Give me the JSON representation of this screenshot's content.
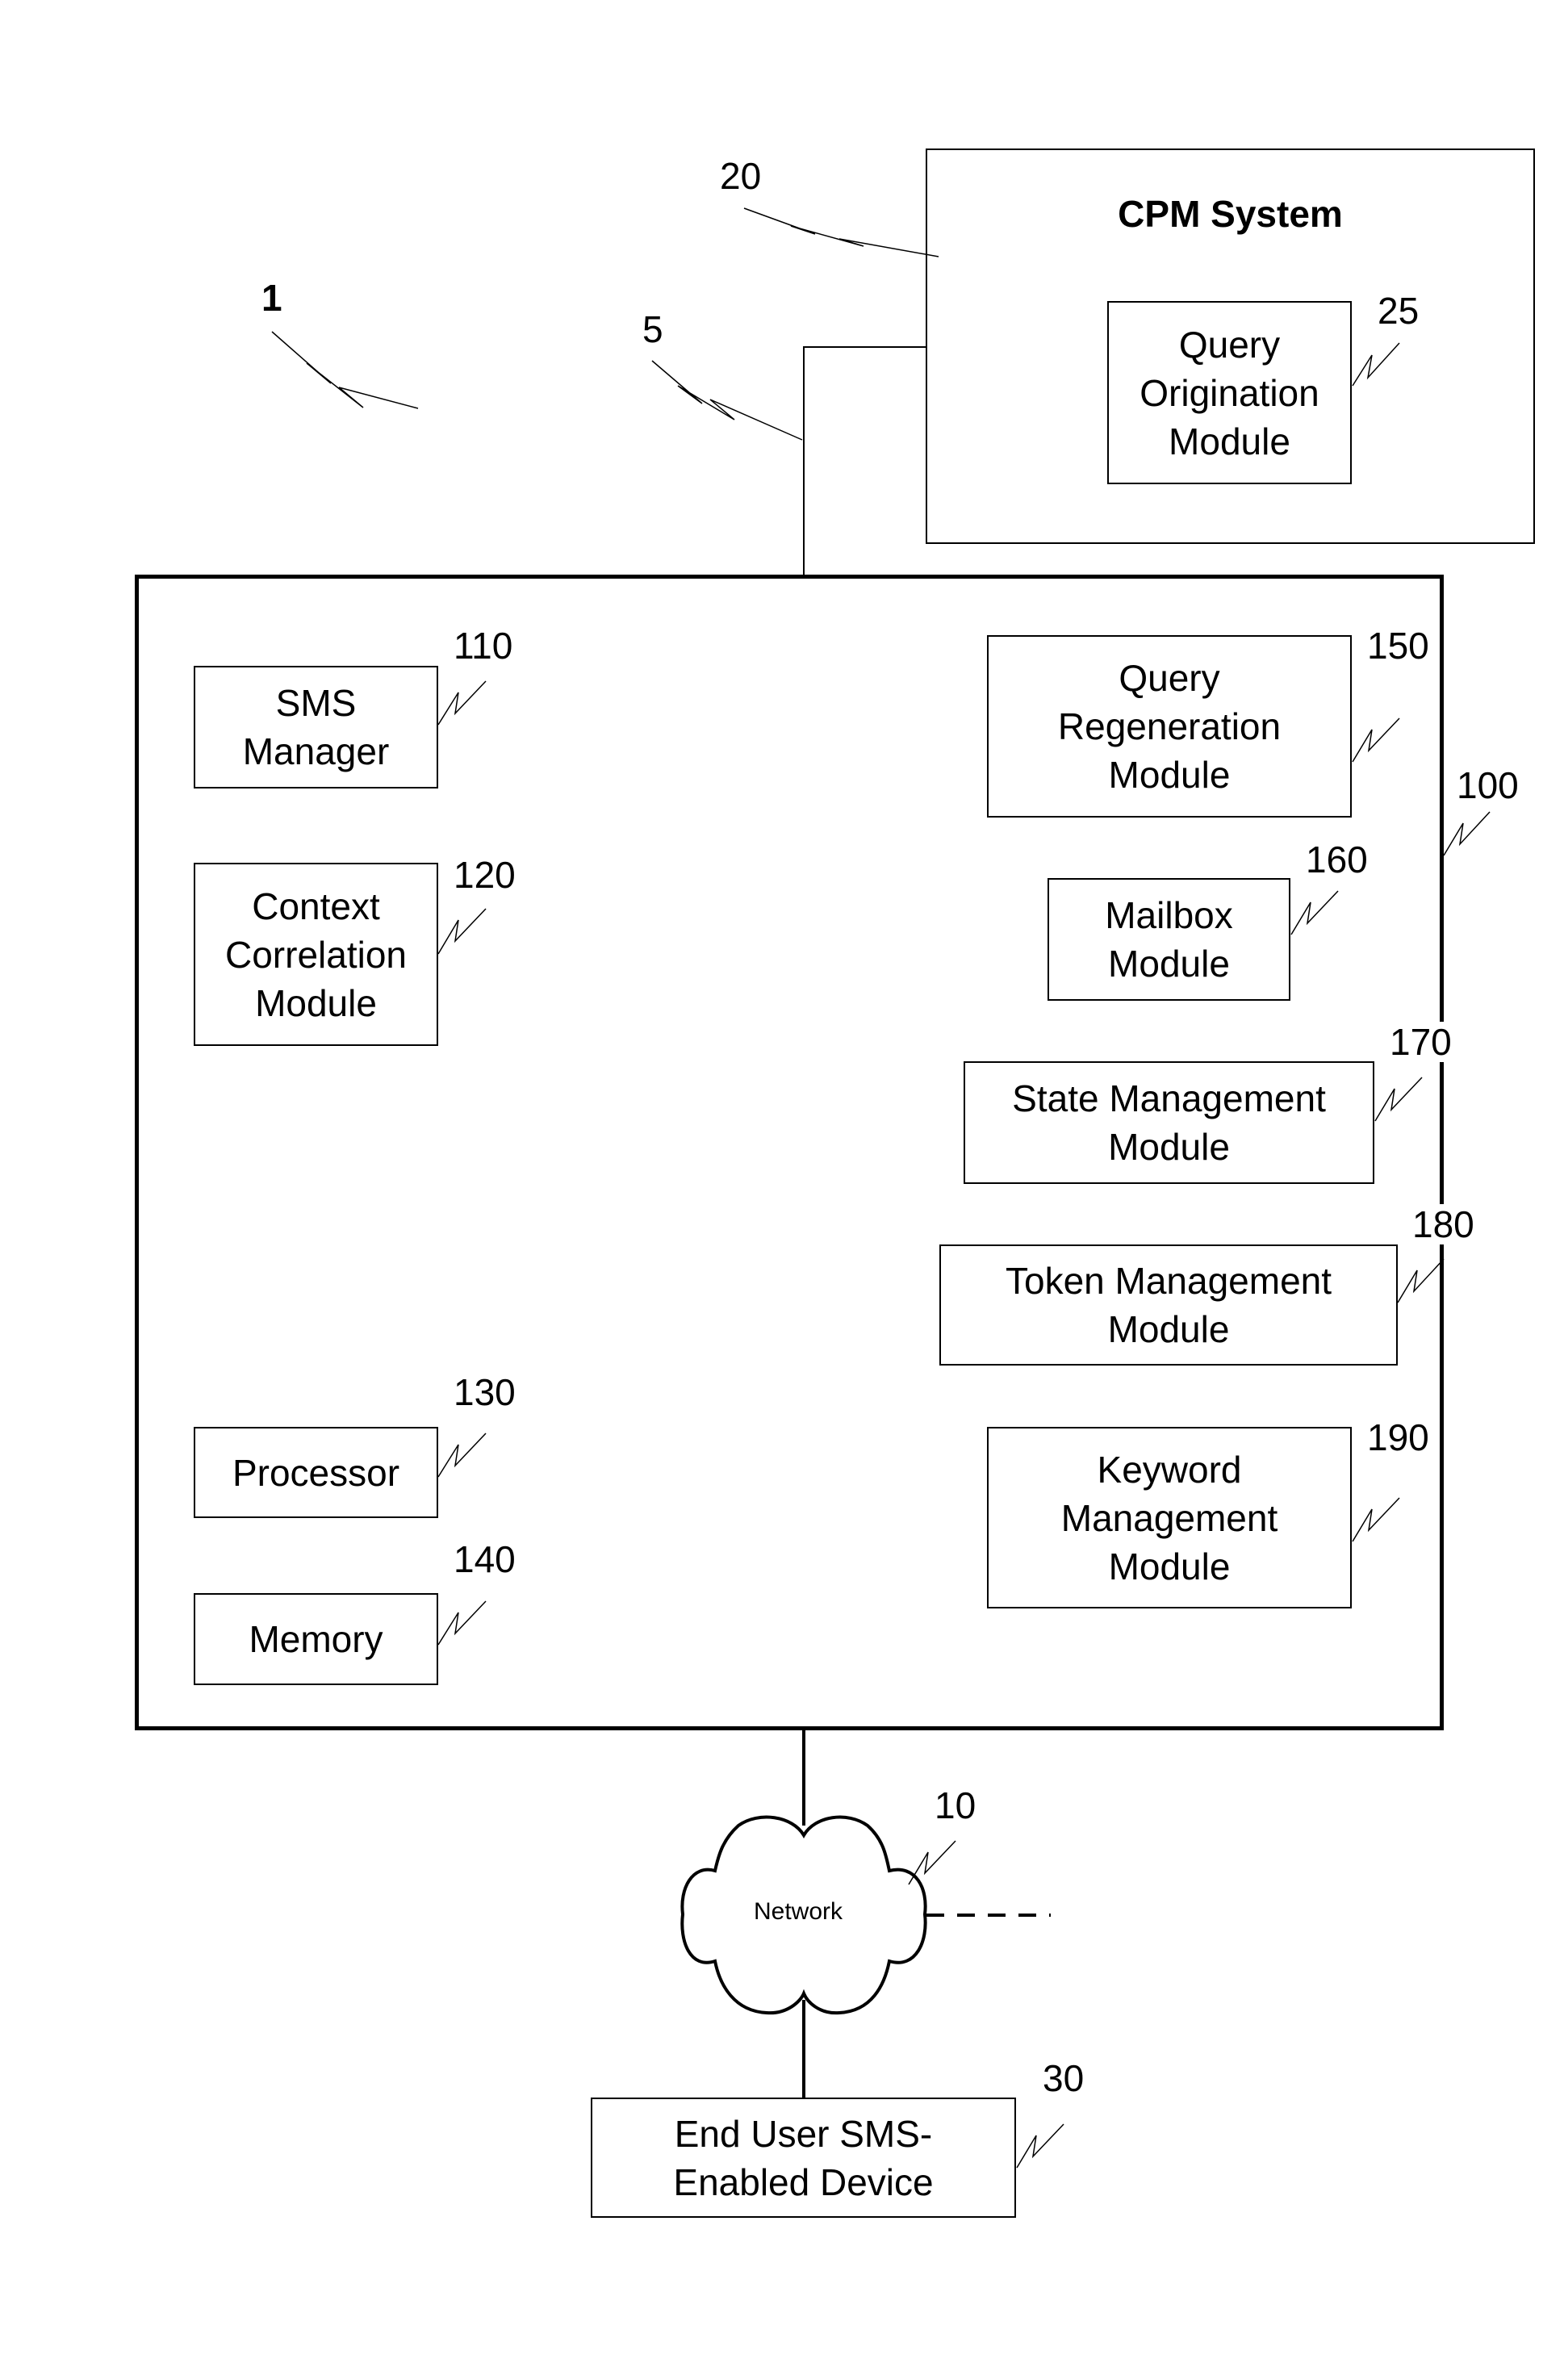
{
  "diagram": {
    "system_ref": "1",
    "connection_ref": "5",
    "cpm_system": {
      "title": "CPM System",
      "ref": "20",
      "query_origination": {
        "label": "Query\nOrigination\nModule",
        "ref": "25"
      }
    },
    "server": {
      "ref": "100",
      "left_modules": [
        {
          "label": "SMS\nManager",
          "ref": "110"
        },
        {
          "label": "Context\nCorrelation\nModule",
          "ref": "120"
        },
        {
          "label": "Processor",
          "ref": "130"
        },
        {
          "label": "Memory",
          "ref": "140"
        }
      ],
      "right_modules": [
        {
          "label": "Query\nRegeneration\nModule",
          "ref": "150"
        },
        {
          "label": "Mailbox\nModule",
          "ref": "160"
        },
        {
          "label": "State Management\nModule",
          "ref": "170"
        },
        {
          "label": "Token Management\nModule",
          "ref": "180"
        },
        {
          "label": "Keyword\nManagement\nModule",
          "ref": "190"
        }
      ]
    },
    "network": {
      "label": "Network",
      "ref": "10"
    },
    "end_user_device": {
      "label": "End User SMS-\nEnabled Device",
      "ref": "30"
    }
  }
}
